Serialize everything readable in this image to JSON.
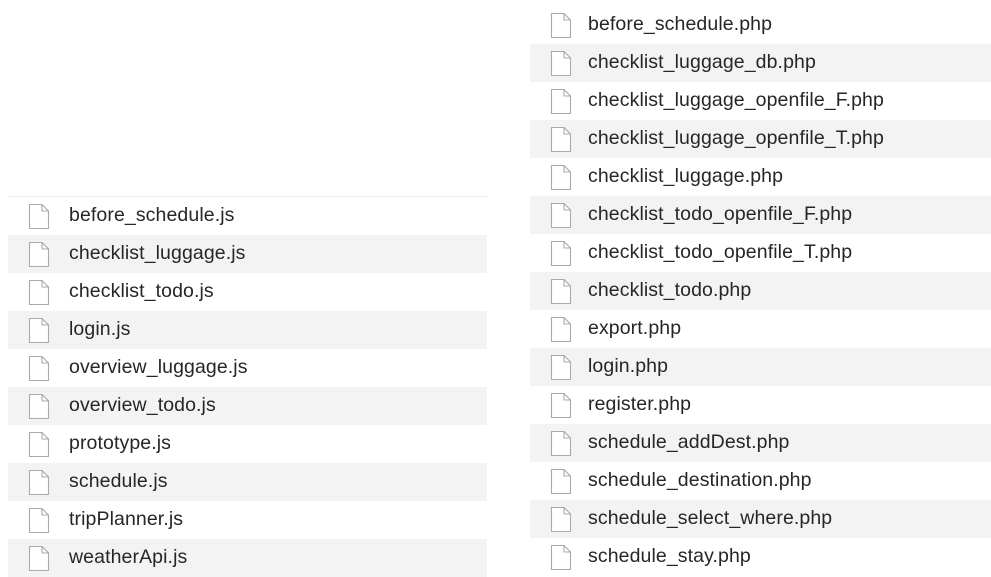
{
  "js_files": [
    {
      "name": "before_schedule.js",
      "icon": "document-icon"
    },
    {
      "name": "checklist_luggage.js",
      "icon": "document-icon"
    },
    {
      "name": "checklist_todo.js",
      "icon": "document-icon"
    },
    {
      "name": "login.js",
      "icon": "document-icon"
    },
    {
      "name": "overview_luggage.js",
      "icon": "document-icon"
    },
    {
      "name": "overview_todo.js",
      "icon": "document-icon"
    },
    {
      "name": "prototype.js",
      "icon": "document-icon"
    },
    {
      "name": "schedule.js",
      "icon": "document-icon"
    },
    {
      "name": "tripPlanner.js",
      "icon": "document-icon"
    },
    {
      "name": "weatherApi.js",
      "icon": "document-icon"
    }
  ],
  "php_files": [
    {
      "name": "before_schedule.php",
      "icon": "document-icon"
    },
    {
      "name": "checklist_luggage_db.php",
      "icon": "document-icon"
    },
    {
      "name": "checklist_luggage_openfile_F.php",
      "icon": "document-icon"
    },
    {
      "name": "checklist_luggage_openfile_T.php",
      "icon": "document-icon"
    },
    {
      "name": "checklist_luggage.php",
      "icon": "document-icon"
    },
    {
      "name": "checklist_todo_openfile_F.php",
      "icon": "document-icon"
    },
    {
      "name": "checklist_todo_openfile_T.php",
      "icon": "document-icon"
    },
    {
      "name": "checklist_todo.php",
      "icon": "document-icon"
    },
    {
      "name": "export.php",
      "icon": "document-icon"
    },
    {
      "name": "login.php",
      "icon": "document-icon"
    },
    {
      "name": "register.php",
      "icon": "document-icon"
    },
    {
      "name": "schedule_addDest.php",
      "icon": "document-icon"
    },
    {
      "name": "schedule_destination.php",
      "icon": "document-icon"
    },
    {
      "name": "schedule_select_where.php",
      "icon": "document-icon"
    },
    {
      "name": "schedule_stay.php",
      "icon": "document-icon"
    }
  ],
  "colors": {
    "row_alt": "#f3f3f3",
    "icon_stroke": "#a9a9a9",
    "text": "#262626"
  }
}
